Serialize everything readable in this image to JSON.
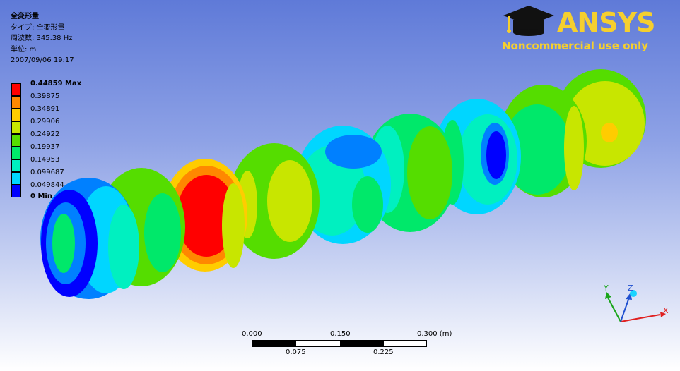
{
  "info": {
    "title": "全変形量",
    "type": "タイプ: 全変形量",
    "frequency": "周波数: 345.38 Hz",
    "unit": "単位: m",
    "date": "2007/09/06 19:17"
  },
  "legend": {
    "levels": [
      "0.44859 Max",
      "0.39875",
      "0.34891",
      "0.29906",
      "0.24922",
      "0.19937",
      "0.14953",
      "0.099687",
      "0.049844",
      "0 Min"
    ],
    "colors": [
      "#ff0000",
      "#ff8800",
      "#ffcc00",
      "#c8e600",
      "#55dd00",
      "#00e86a",
      "#00f0c0",
      "#00d6ff",
      "#0080ff",
      "#0000ff"
    ]
  },
  "logo": {
    "brand": "ANSYS",
    "note": "Noncommercial use only",
    "icon": "graduation-cap-icon",
    "color": "#f5cf2e"
  },
  "scale_bar": {
    "top_labels": [
      "0.000",
      "0.150",
      "0.300 (m)"
    ],
    "bottom_labels": [
      "0.075",
      "0.225"
    ]
  },
  "triad": {
    "x": "X",
    "y": "Y",
    "z": "Z"
  }
}
